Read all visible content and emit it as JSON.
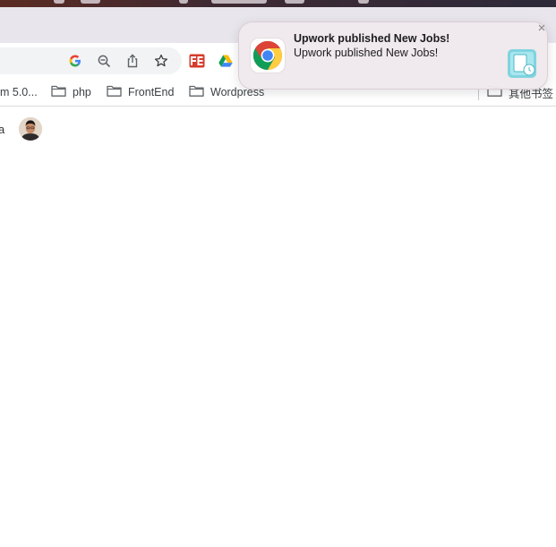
{
  "notification": {
    "title": "Upwork published New Jobs!",
    "body": "Upwork published New Jobs!",
    "app_icon": "chrome-icon",
    "thumbnail_icon": "document-clock-icon"
  },
  "toolbar": {
    "icons": [
      "google-icon",
      "zoom-out-icon",
      "share-icon",
      "star-icon",
      "extension-fe-icon",
      "google-drive-icon"
    ]
  },
  "bookmarks": {
    "items": [
      {
        "label": "m 5.0..."
      },
      {
        "label": "php"
      },
      {
        "label": "FrontEnd"
      },
      {
        "label": "Wordpress"
      }
    ],
    "other_label": "其他书签"
  },
  "page": {
    "partial_text": "a"
  },
  "colors": {
    "accent_blue": "#1a73e8",
    "menubar": "#3e2a33"
  }
}
